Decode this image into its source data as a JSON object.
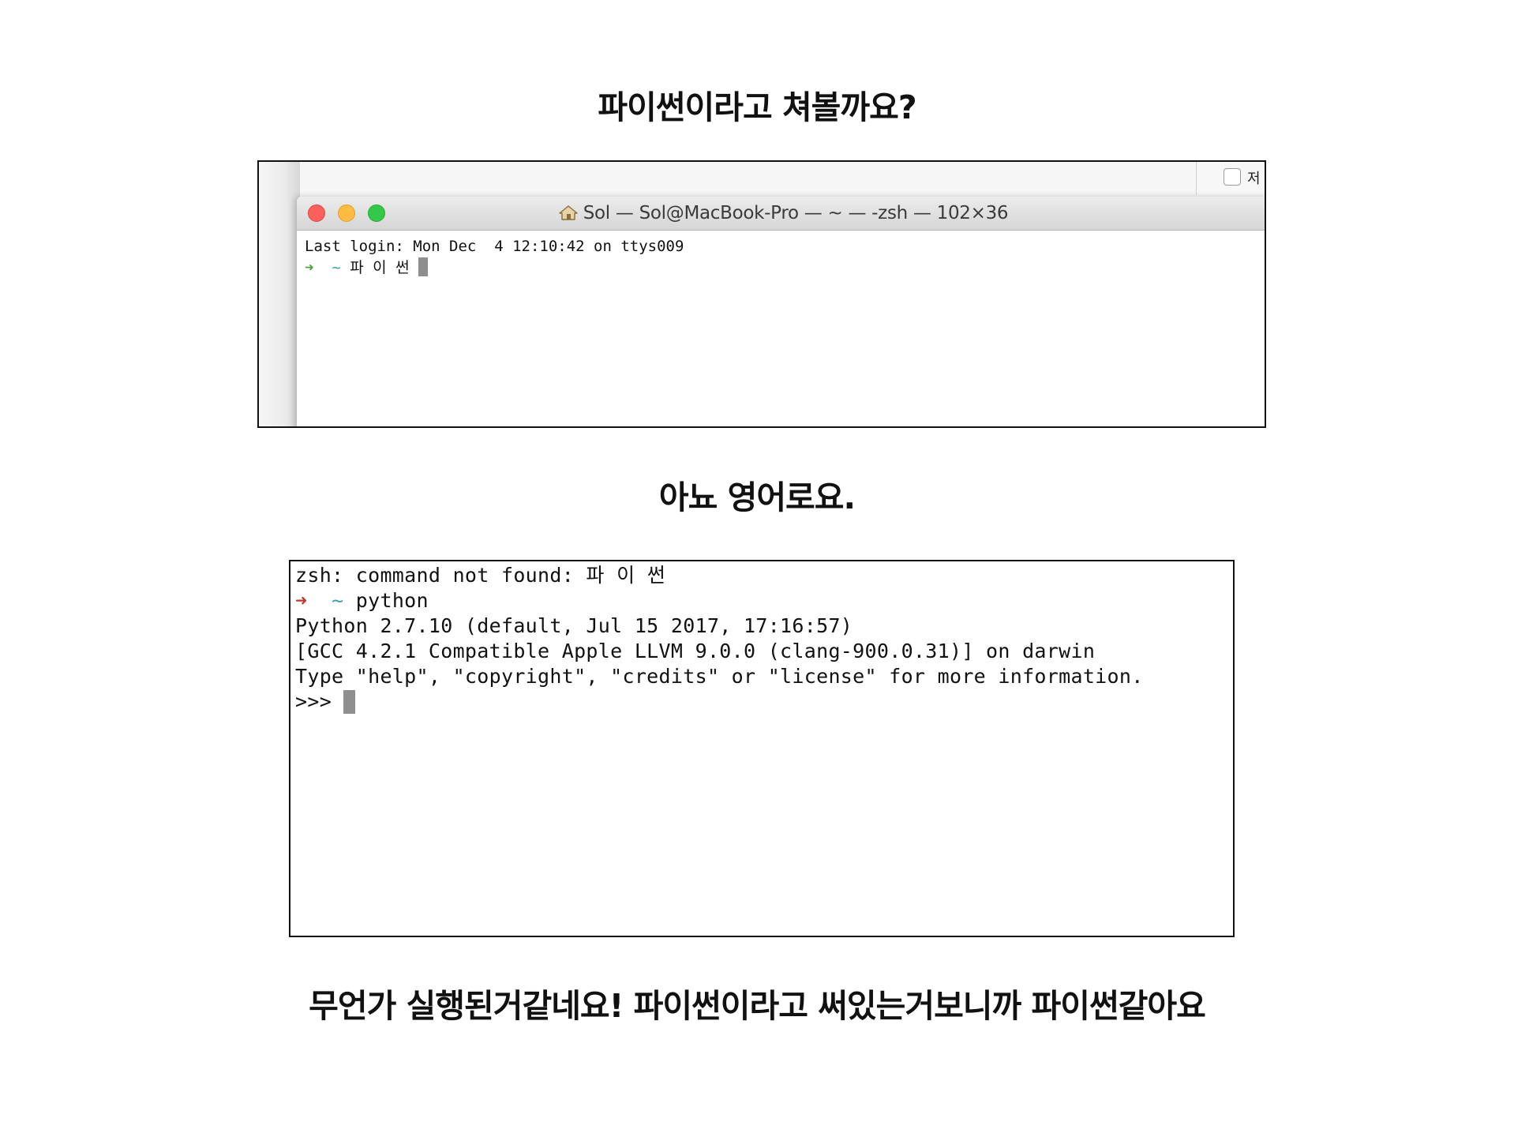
{
  "captions": {
    "top": "파이썬이라고 쳐볼까요?",
    "middle": "아뇨 영어로요.",
    "bottom": "무언가 실행된거같네요! 파이썬이라고 써있는거보니까 파이썬같아요"
  },
  "terminal1": {
    "title": "Sol — Sol@MacBook-Pro — ~ — -zsh — 102×36",
    "background_checkbox_label": "저",
    "lines": {
      "login": "Last login: Mon Dec  4 12:10:42 on ttys009",
      "prompt_arrow": "➜",
      "prompt_dir": "~",
      "command": "파 이 썬"
    }
  },
  "terminal2": {
    "lines": {
      "error": "zsh: command not found: 파 이 썬",
      "prompt_arrow": "➜",
      "prompt_dir": "~",
      "command": "python",
      "version": "Python 2.7.10 (default, Jul 15 2017, 17:16:57)",
      "compiler": "[GCC 4.2.1 Compatible Apple LLVM 9.0.0 (clang-900.0.31)] on darwin",
      "help": "Type \"help\", \"copyright\", \"credits\" or \"license\" for more information.",
      "repl_prompt": ">>>"
    }
  },
  "colors": {
    "prompt_ok": "#3daa2c",
    "prompt_error": "#c0392b",
    "tilde": "#3a9fbf",
    "close": "#fc605c",
    "minimize": "#fdbc40",
    "maximize": "#34c84a"
  },
  "icons": [
    "home-icon",
    "close-traffic-light",
    "minimize-traffic-light",
    "maximize-traffic-light",
    "cursor-block"
  ]
}
